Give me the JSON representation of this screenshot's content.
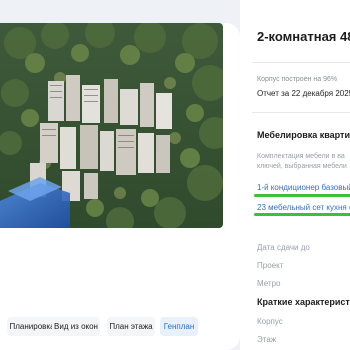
{
  "gallery": {
    "tabs": [
      {
        "label": "Планировка",
        "active": false
      },
      {
        "label": "Вид из окон",
        "active": false
      },
      {
        "label": "План этажа",
        "active": false
      },
      {
        "label": "Генплан",
        "active": true
      }
    ]
  },
  "info": {
    "title": "2-комнатная 48",
    "build_progress_text": "Корпус построен на 96%",
    "report_date": "Отчет за 22 декабря 2025",
    "furniture": {
      "heading": "Мебелировка квартиры",
      "description_lines": [
        "Комплектация мебели в ва",
        "ключей, выбранная мебели"
      ],
      "links": [
        "1-й кондиционер базовый",
        "23 мебельный сет кухня ст"
      ],
      "highlight_color": "#3cbf3a"
    },
    "params": {
      "delivery_label": "Дата сдачи до",
      "project_label": "Проект",
      "metro_label": "Метро"
    },
    "short": {
      "heading": "Краткие характеристи",
      "building_label": "Корпус",
      "floor_label": "Этаж"
    }
  },
  "colors": {
    "accent": "#2f72d3",
    "green_highlight": "#3cbf3a",
    "background": "#eef1f6"
  }
}
